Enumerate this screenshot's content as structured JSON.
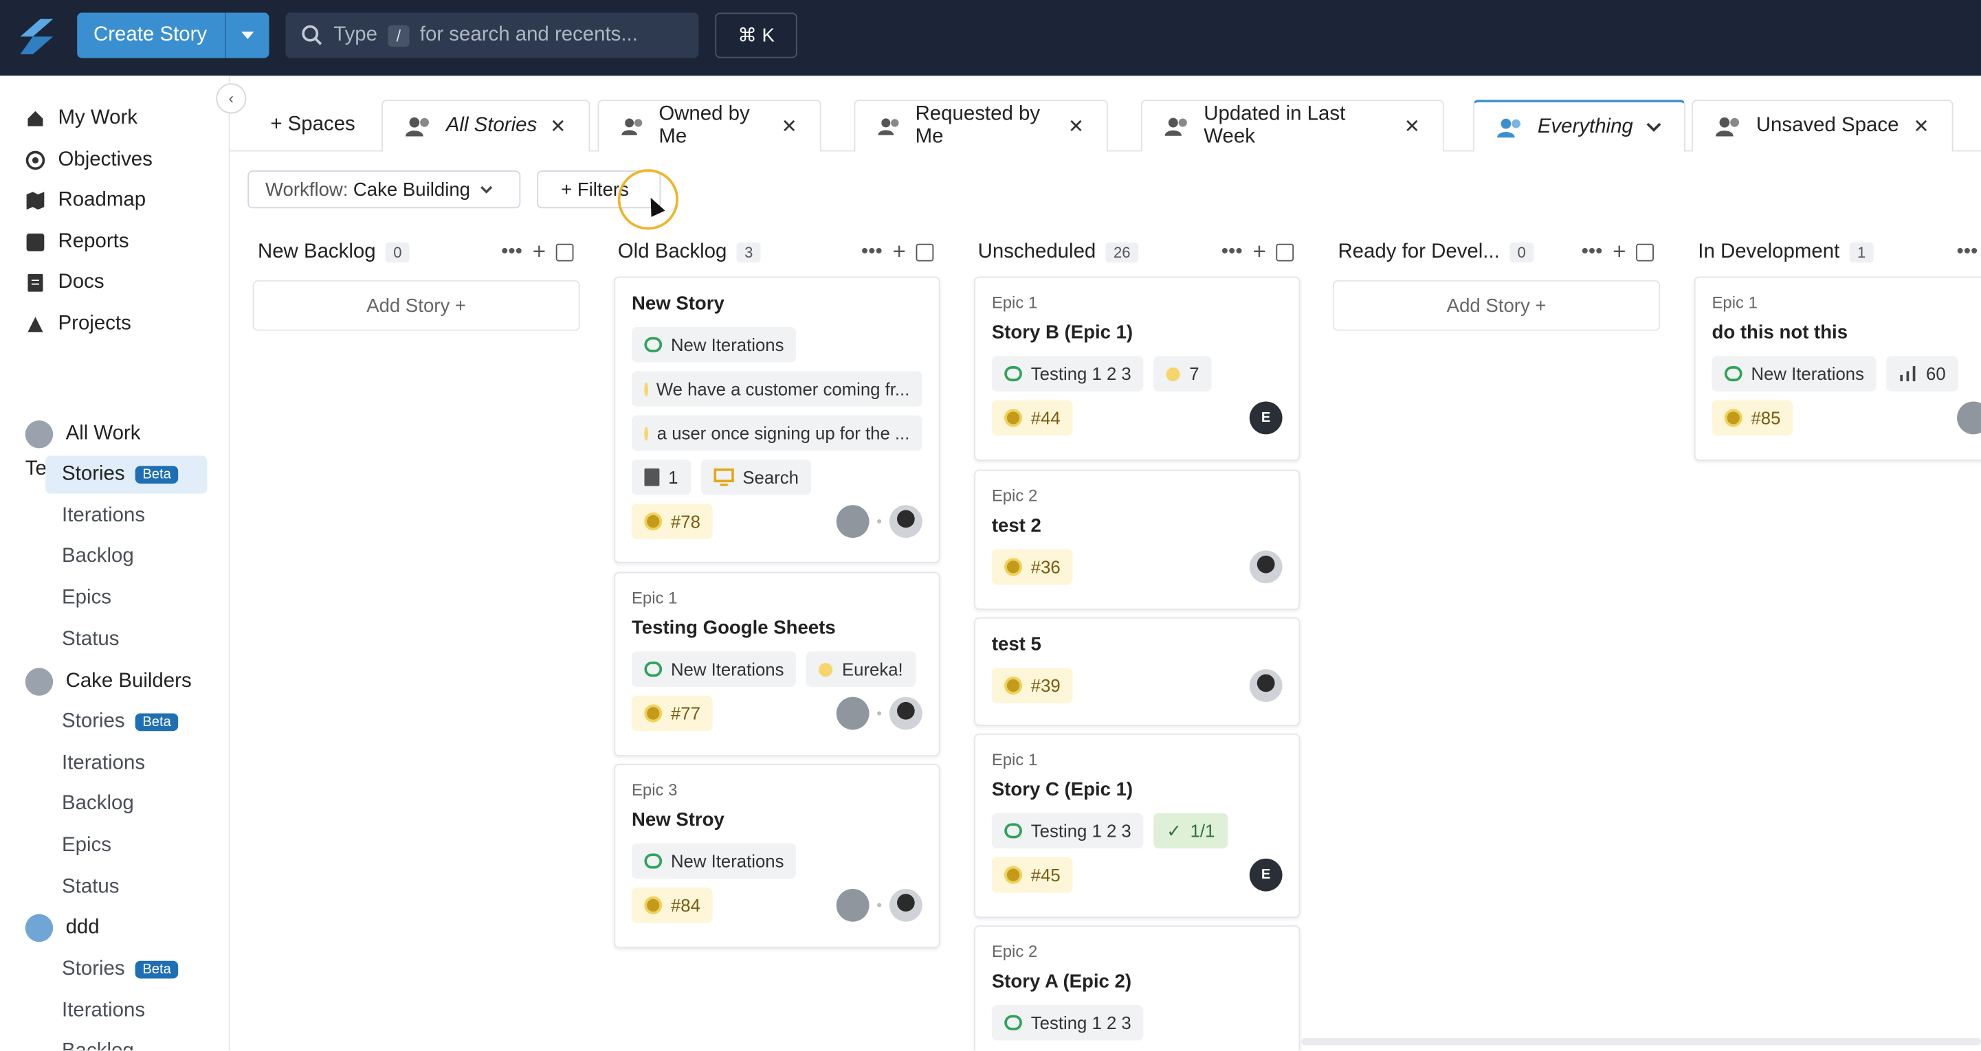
{
  "topbar": {
    "create_label": "Create Story",
    "search_prefix": "Type",
    "search_key": "/",
    "search_suffix": "for search and recents...",
    "shortcut": "⌘ K"
  },
  "sidebar": {
    "nav": [
      "My Work",
      "Objectives",
      "Roadmap",
      "Reports",
      "Docs",
      "Projects"
    ],
    "teams_label": "Teams",
    "teams_more": "•••",
    "beta": "Beta",
    "teams": [
      {
        "name": "All Work",
        "items": [
          "Stories",
          "Iterations",
          "Backlog",
          "Epics",
          "Status"
        ]
      },
      {
        "name": "Cake Builders",
        "items": [
          "Stories",
          "Iterations",
          "Backlog",
          "Epics",
          "Status"
        ]
      },
      {
        "name": "ddd",
        "items": [
          "Stories",
          "Iterations",
          "Backlog"
        ]
      }
    ]
  },
  "tabs": {
    "spaces": "+ Spaces",
    "items": [
      "All Stories",
      "Owned by Me",
      "Requested by Me",
      "Updated in Last Week",
      "Everything",
      "Unsaved Space"
    ]
  },
  "filterbar": {
    "workflow_prefix": "Workflow:",
    "workflow_value": "Cake Building",
    "filters": "+ Filters"
  },
  "columns": [
    {
      "name": "New Backlog",
      "count": "0",
      "add": "Add Story +"
    },
    {
      "name": "Old Backlog",
      "count": "3"
    },
    {
      "name": "Unscheduled",
      "count": "26"
    },
    {
      "name": "Ready for Devel...",
      "count": "0",
      "add": "Add Story +"
    },
    {
      "name": "In Development",
      "count": "1"
    }
  ],
  "cards": {
    "ob1": {
      "title": "New Story",
      "iteration": "New Iterations",
      "note1": "We have a customer coming fr...",
      "note2": "a user once signing up for the ...",
      "docs": "1",
      "label": "Search",
      "id": "#78"
    },
    "ob2": {
      "epic": "Epic 1",
      "title": "Testing Google Sheets",
      "iteration": "New Iterations",
      "label": "Eureka!",
      "id": "#77"
    },
    "ob3": {
      "epic": "Epic 3",
      "title": "New Stroy",
      "iteration": "New Iterations",
      "id": "#84"
    },
    "un1": {
      "epic": "Epic 1",
      "title": "Story B (Epic 1)",
      "iteration": "Testing 1 2 3",
      "est": "7",
      "id": "#44",
      "owner": "E"
    },
    "un2": {
      "epic": "Epic 2",
      "title": "test 2",
      "id": "#36"
    },
    "un3": {
      "title": "test 5",
      "id": "#39"
    },
    "un4": {
      "epic": "Epic 1",
      "title": "Story C (Epic 1)",
      "iteration": "Testing 1 2 3",
      "tasks": "1/1",
      "id": "#45",
      "owner": "E"
    },
    "un5": {
      "epic": "Epic 2",
      "title": "Story A (Epic 2)",
      "iteration": "Testing 1 2 3"
    },
    "id1": {
      "epic": "Epic 1",
      "title": "do this not this",
      "iteration": "New Iterations",
      "est": "60",
      "id": "#85"
    }
  },
  "colors": {
    "topbar": "#1b2537",
    "accent": "#3a8fd1",
    "selected_nav": "#e1eef9"
  }
}
